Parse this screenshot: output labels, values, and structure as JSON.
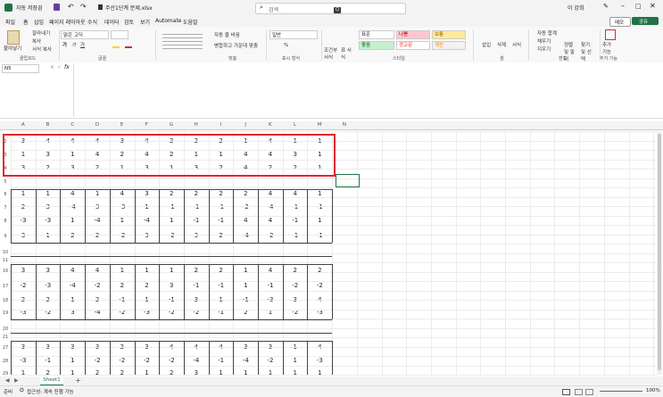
{
  "titlebar": {
    "autosave": "자동 저장",
    "autosave_state": "끔",
    "filename": "주산1단계 문제.xlsx",
    "search_placeholder": "검색",
    "user": "이 강희"
  },
  "tabs": [
    "파일",
    "홈",
    "삽입",
    "페이지 레이아웃",
    "수식",
    "데이터",
    "검토",
    "보기",
    "Automate",
    "도움말"
  ],
  "ribbon": {
    "paste": "붙여넣기",
    "cut": "잘라내기",
    "copy": "복사",
    "format_painter": "서식 복사",
    "clipboard": "클립보드",
    "font_name": "맑은 고딕",
    "font_group": "글꼴",
    "wrap_text": "자동 줄 바꿈",
    "merge_center": "병합하고 가운데 맞춤",
    "align_group": "맞춤",
    "number_format": "일반",
    "number_group": "표시 형식",
    "cond_format": "조건부 서식",
    "table_format": "표 서식",
    "style_normal": "표준",
    "style_bad": "나쁨",
    "style_neutral": "보통",
    "style_good": "좋음",
    "style_warning": "경고문",
    "style_calc": "계산",
    "style_group": "스타일",
    "insert": "삽입",
    "delete": "삭제",
    "format": "서식",
    "cell_group": "셀",
    "autosum": "자동 합계",
    "fill": "채우기",
    "clear": "지우기",
    "sort_filter": "정렬 및 필터",
    "find_select": "찾기 및 선택",
    "edit_group": "편집",
    "addins": "추가 기능",
    "addins_group": "추가 기능",
    "share": "공유",
    "comment": "메모"
  },
  "formula": {
    "namebox": "N5",
    "fx": "fx"
  },
  "columns": [
    "A",
    "B",
    "C",
    "D",
    "E",
    "F",
    "G",
    "H",
    "I",
    "J",
    "K",
    "L",
    "M",
    "N"
  ],
  "rows": [
    {
      "num": "2",
      "values": [
        "3",
        "4",
        "4",
        "4",
        "3",
        "4",
        "2",
        "2",
        "2",
        "1",
        "4",
        "1",
        "1"
      ]
    },
    {
      "num": "3",
      "values": [
        "1",
        "3",
        "1",
        "4",
        "2",
        "4",
        "2",
        "1",
        "1",
        "4",
        "4",
        "3",
        "1"
      ]
    },
    {
      "num": "4",
      "values": [
        "3",
        "2",
        "3",
        "2",
        "1",
        "3",
        "1",
        "3",
        "2",
        "4",
        "2",
        "2",
        "1"
      ]
    },
    {
      "num": "5",
      "values": [
        "",
        "",
        "",
        "",
        "",
        "",
        "",
        "",
        "",
        "",
        "",
        "",
        ""
      ]
    },
    {
      "num": "6",
      "values": [
        "1",
        "1",
        "4",
        "1",
        "4",
        "3",
        "2",
        "2",
        "2",
        "2",
        "4",
        "4",
        "1"
      ]
    },
    {
      "num": "7",
      "values": [
        "2",
        "3",
        "-4",
        "3",
        "-3",
        "1",
        "-1",
        "-1",
        "-1",
        "-2",
        "-4",
        "-1",
        "-1"
      ]
    },
    {
      "num": "8",
      "values": [
        "-3",
        "-3",
        "1",
        "-4",
        "1",
        "-4",
        "1",
        "-1",
        "-1",
        "4",
        "4",
        "-1",
        "1"
      ]
    },
    {
      "num": "9",
      "values": [
        "3",
        "1",
        "2",
        "2",
        "-2",
        "3",
        "-2",
        "3",
        "2",
        "-4",
        "-2",
        "-1",
        "-1"
      ]
    },
    {
      "num": "10",
      "values": [
        "",
        "",
        "",
        "",
        "",
        "",
        "",
        "",
        "",
        "",
        "",
        "",
        ""
      ]
    },
    {
      "num": "11",
      "values": [
        "",
        "",
        "",
        "",
        "",
        "",
        "",
        "",
        "",
        "",
        "",
        "",
        ""
      ]
    },
    {
      "num": "16",
      "values": [
        "3",
        "3",
        "4",
        "4",
        "1",
        "1",
        "1",
        "2",
        "2",
        "1",
        "4",
        "2",
        "2"
      ]
    },
    {
      "num": "17",
      "values": [
        "-2",
        "-3",
        "-4",
        "-2",
        "2",
        "2",
        "3",
        "-1",
        "-1",
        "1",
        "-1",
        "-2",
        "-2"
      ]
    },
    {
      "num": "18",
      "values": [
        "2",
        "2",
        "1",
        "2",
        "-1",
        "1",
        "-1",
        "3",
        "1",
        "-1",
        "-3",
        "3",
        "4"
      ]
    },
    {
      "num": "19",
      "values": [
        "-3",
        "-2",
        "3",
        "-4",
        "-2",
        "-3",
        "-2",
        "-2",
        "-1",
        "2",
        "1",
        "-2",
        "-3"
      ]
    },
    {
      "num": "20",
      "values": [
        "",
        "",
        "",
        "",
        "",
        "",
        "",
        "",
        "",
        "",
        "",
        "",
        ""
      ]
    },
    {
      "num": "21",
      "values": [
        "",
        "",
        "",
        "",
        "",
        "",
        "",
        "",
        "",
        "",
        "",
        "",
        ""
      ]
    },
    {
      "num": "27",
      "values": [
        "3",
        "3",
        "3",
        "3",
        "2",
        "3",
        "4",
        "4",
        "4",
        "3",
        "3",
        "1",
        "4"
      ]
    },
    {
      "num": "28",
      "values": [
        "-3",
        "-1",
        "1",
        "-2",
        "-2",
        "-2",
        "-2",
        "-4",
        "-1",
        "-4",
        "-2",
        "1",
        "-3"
      ]
    },
    {
      "num": "29",
      "values": [
        "1",
        "2",
        "1",
        "2",
        "2",
        "1",
        "2",
        "3",
        "1",
        "1",
        "1",
        "1",
        "1"
      ]
    }
  ],
  "sheet": {
    "name": "Sheet1"
  },
  "status": {
    "ready": "준비",
    "accessibility": "접근성: 계속 진행 가능",
    "zoom": "100%"
  }
}
